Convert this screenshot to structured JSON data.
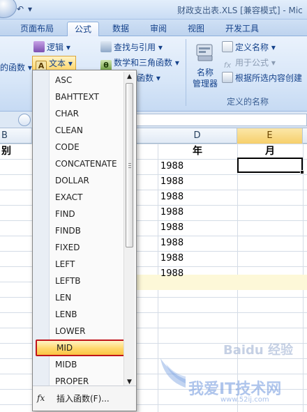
{
  "window": {
    "title": "财政支出表.XLS  [兼容模式] - Mic",
    "qat": [
      "undo-arrow-icon",
      "customize-qat-icon"
    ]
  },
  "tabs": [
    {
      "label": "页面布局",
      "active": false
    },
    {
      "label": "公式",
      "active": true
    },
    {
      "label": "数据",
      "active": false
    },
    {
      "label": "审阅",
      "active": false
    },
    {
      "label": "视图",
      "active": false
    },
    {
      "label": "开发工具",
      "active": false
    }
  ],
  "ribbon": {
    "left_fragment": "的函数",
    "logic": "逻辑",
    "text": "文本",
    "lookup": "查找与引用",
    "math": "数学和三角函数",
    "other_fragment": "函数",
    "name_manager": "名称\n管理器",
    "define_name": "定义名称",
    "use_in_formula": "用于公式",
    "create_from_selection": "根据所选内容创建",
    "group_defined_names": "定义的名称"
  },
  "columns": {
    "b": "B",
    "d": "D",
    "e": "E"
  },
  "headers_row": {
    "b": "别",
    "d": "年",
    "e": "月"
  },
  "year_values": [
    "1988",
    "1988",
    "1988",
    "1988",
    "1988",
    "1988",
    "1988",
    "1988"
  ],
  "menu": {
    "items": [
      "ASC",
      "BAHTTEXT",
      "CHAR",
      "CLEAN",
      "CODE",
      "CONCATENATE",
      "DOLLAR",
      "EXACT",
      "FIND",
      "FINDB",
      "FIXED",
      "LEFT",
      "LEFTB",
      "LEN",
      "LENB",
      "LOWER",
      "MID",
      "MIDB",
      "PROPER"
    ],
    "selected": "MID",
    "footer_icon": "fx",
    "footer_label": "插入函数(F)...",
    "accent_color": "#c0141a"
  },
  "watermark": {
    "line1": "Baidu 经验",
    "line2": "我爱IT技术网",
    "line3": "www.52ij.com"
  }
}
